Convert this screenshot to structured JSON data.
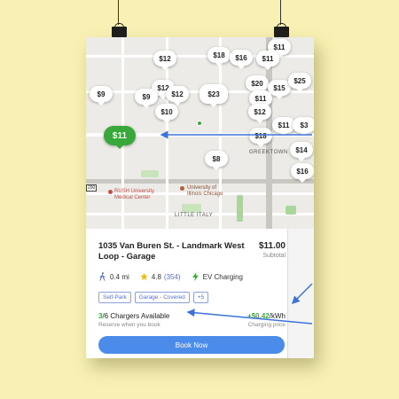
{
  "map": {
    "labels": {
      "greektown": "GREEKTOWN",
      "little_italy": "LITTLE ITALY",
      "highway": "290"
    },
    "pois": {
      "rush": {
        "line1": "RUSH University",
        "line2": "Medical Center"
      },
      "uic": {
        "line1": "University of",
        "line2": "Illinois Chicago"
      }
    },
    "price_pins": [
      "$11",
      "$18",
      "$16",
      "$12",
      "$11",
      "$12",
      "$9",
      "$12",
      "$9",
      "$10",
      "$23",
      "$20",
      "$15",
      "$25",
      "$11",
      "$12",
      "$11",
      "$3",
      "$18",
      "$8",
      "$14",
      "$16"
    ],
    "selected_pin": "$11"
  },
  "listing": {
    "title": "1035 Van Buren St. - Landmark West Loop - Garage",
    "price": "$11.00",
    "price_caption": "Subtotal",
    "distance": "0.4 mi",
    "rating": "4.8",
    "reviews": "(354)",
    "ev_label": "EV Charging",
    "tags": [
      "Self-Park",
      "Garage - Covered",
      "+5"
    ],
    "chargers_available": "3",
    "chargers_total": "/6 Chargers Available",
    "reserve_note": "Reserve when you book",
    "charging_rate": "+$0.42",
    "charging_unit": "/kWh",
    "charging_caption": "Charging price",
    "book_button": "Book Now"
  },
  "colors": {
    "accent_blue": "#4b8bea",
    "ev_green": "#39a83a",
    "star": "#f4b400",
    "background": "#f8f1b3"
  }
}
